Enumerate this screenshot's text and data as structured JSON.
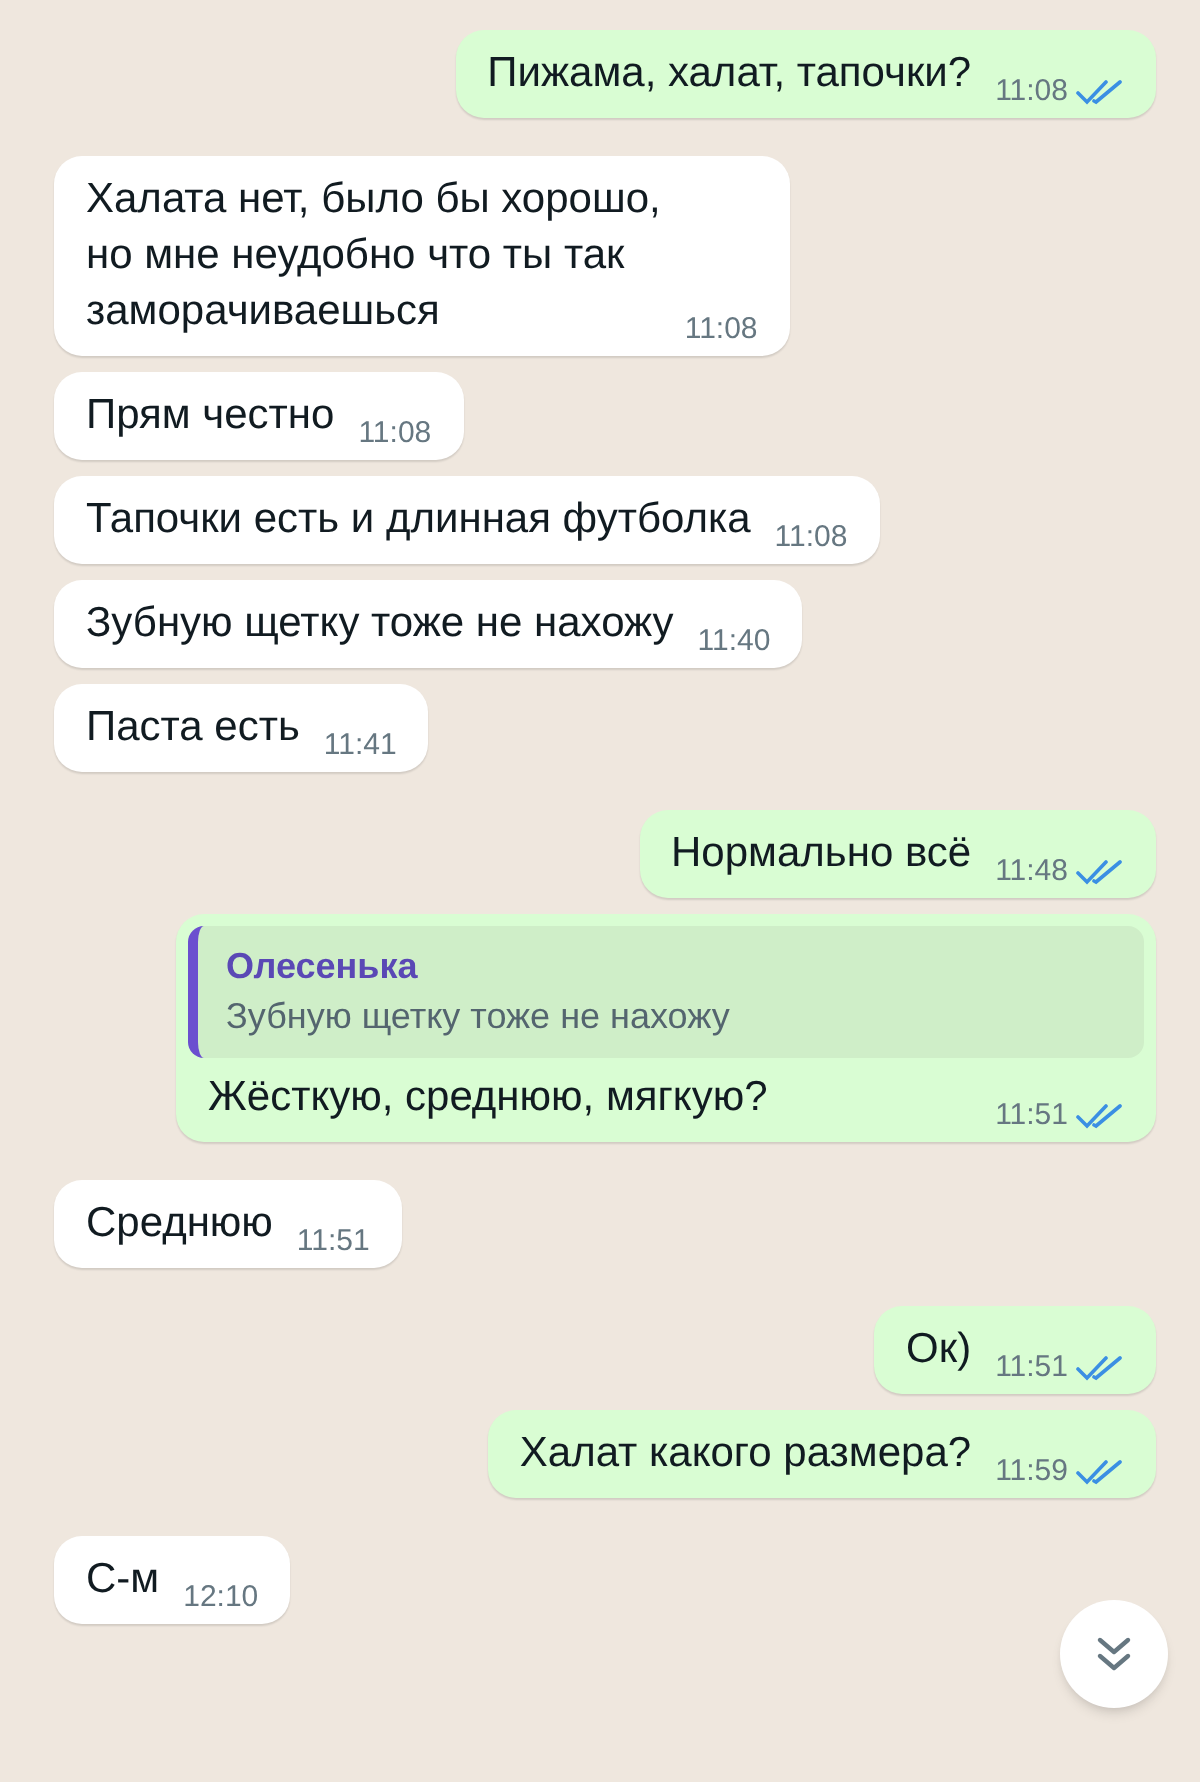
{
  "messages": [
    {
      "kind": "outgoing",
      "text": "Пижама, халат, тапочки?",
      "time": "11:08",
      "read": true
    },
    {
      "kind": "incoming",
      "text": "Халата нет, было бы хорошо,\nно мне неудобно что ты так\nзаморачиваешься",
      "time": "11:08"
    },
    {
      "kind": "incoming",
      "text": "Прям честно",
      "time": "11:08"
    },
    {
      "kind": "incoming",
      "text": "Тапочки есть и длинная футболка",
      "time": "11:08"
    },
    {
      "kind": "incoming",
      "text": "Зубную щетку тоже не нахожу",
      "time": "11:40"
    },
    {
      "kind": "incoming",
      "text": "Паста есть",
      "time": "11:41"
    },
    {
      "kind": "outgoing",
      "text": "Нормально всё",
      "time": "11:48",
      "read": true
    },
    {
      "kind": "outgoing",
      "reply_to": {
        "author": "Олесенька",
        "text": "Зубную щетку тоже не нахожу"
      },
      "text": "Жёсткую, среднюю, мягкую?",
      "time": "11:51",
      "read": true
    },
    {
      "kind": "incoming",
      "text": "Среднюю",
      "time": "11:51"
    },
    {
      "kind": "outgoing",
      "text": "Ок)",
      "time": "11:51",
      "read": true
    },
    {
      "kind": "outgoing",
      "text": "Халат какого размера?",
      "time": "11:59",
      "read": true
    },
    {
      "kind": "incoming",
      "text": "С-м",
      "time": "12:10"
    }
  ]
}
